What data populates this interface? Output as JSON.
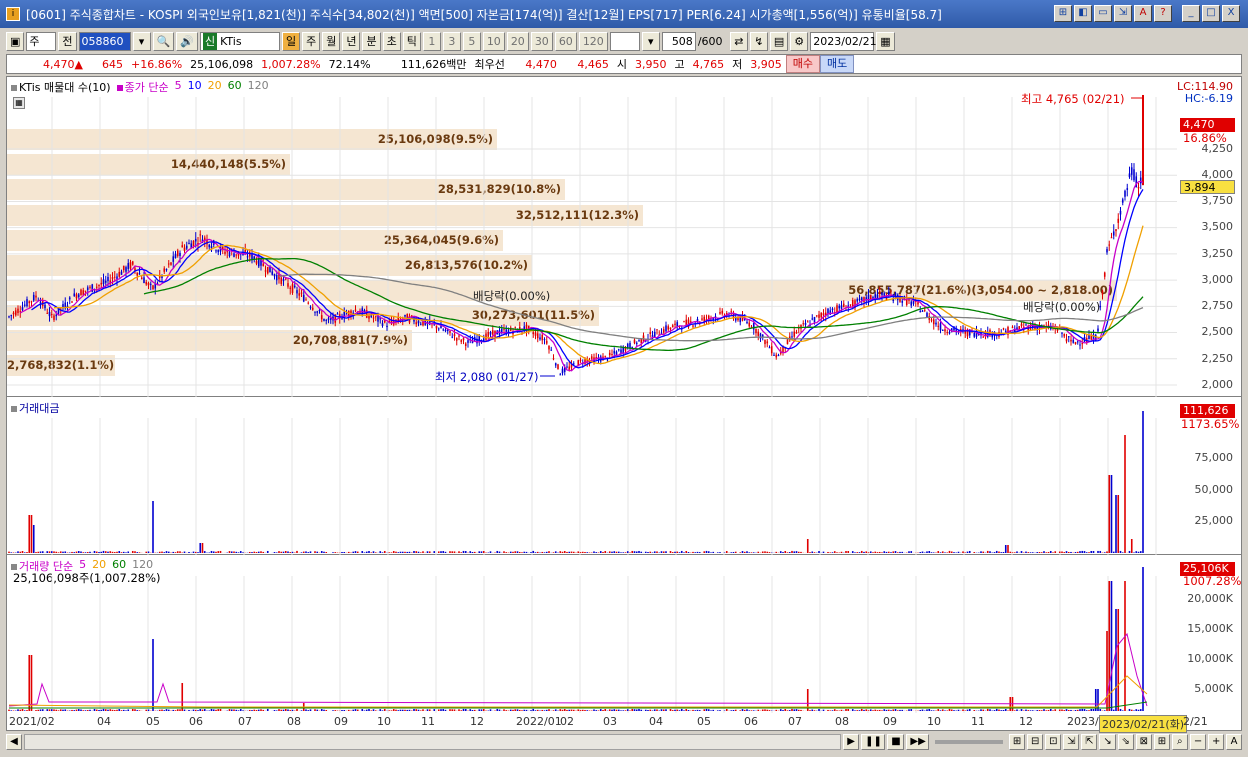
{
  "window": {
    "title": "[0601] 주식종합차트 - KOSPI 외국인보유[1,821(천)] 주식수[34,802(천)] 액면[500] 자본금[174(억)] 결산[12월] EPS[717] PER[6.24] 시가총액[1,556(억)] 유통비율[58.7]",
    "icon": "i",
    "btns": [
      "⊞",
      "◧",
      "▭",
      "⇲",
      "A",
      "?"
    ],
    "ctrl": [
      "_",
      "□",
      "X"
    ]
  },
  "toolbar": {
    "type": "주",
    "mode": "전",
    "code": "058860",
    "name": "KTis",
    "name_badge": "신",
    "periods": [
      "일",
      "주",
      "월",
      "년",
      "분",
      "초",
      "틱"
    ],
    "nums": [
      "1",
      "3",
      "5",
      "10",
      "20",
      "30",
      "60",
      "120"
    ],
    "count": "508",
    "count_max": "/600",
    "date": "2023/02/21"
  },
  "quote": {
    "price": "4,470▲",
    "change": "645",
    "rate": "+16.86%",
    "volume": "25,106,098",
    "vol_rate": "1,007.28%",
    "turnover": "72.14%",
    "amount": "111,626백만",
    "pref_label": "최우선",
    "ask": "4,470",
    "bid": "4,465",
    "open_label": "시",
    "open": "3,950",
    "high_label": "고",
    "high": "4,765",
    "low_label": "저",
    "low": "3,905",
    "buy_label": "매수",
    "sell_label": "매도"
  },
  "price_pane": {
    "legend_title": "KTis 매물대 수(10)",
    "ma_label": "종가 단순",
    "ma_periods": [
      "5",
      "10",
      "20",
      "60",
      "120"
    ],
    "lc": "LC:114.90",
    "hc": "HC:-6.19",
    "yaxis": [
      "4,250",
      "4,000",
      "3,750",
      "3,500",
      "3,250",
      "3,000",
      "2,750",
      "2,500",
      "2,250",
      "2,000"
    ],
    "tag_price": "4,470",
    "tag_rate": "16.86%",
    "tag_ma": "3,894",
    "high_note": "최고 4,765 (02/21)",
    "low_note": "최저 2,080 (01/27)",
    "div1": "배당락(0.00%)",
    "div2": "배당락(0.00%)",
    "profile": [
      "25,106,098(9.5%)",
      "14,440,148(5.5%)",
      "28,531,829(10.8%)",
      "32,512,111(12.3%)",
      "25,364,045(9.6%)",
      "26,813,576(10.2%)",
      "56,855,787(21.6%)(3,054.00 ~ 2,818.00)",
      "30,273,601(11.5%)",
      "20,708,881(7.9%)",
      "2,768,832(1.1%)"
    ]
  },
  "amount_pane": {
    "legend": "거래대금",
    "yaxis": [
      "75,000",
      "50,000",
      "25,000"
    ],
    "tag": "111,626",
    "tag_rate": "1173.65%"
  },
  "volume_pane": {
    "legend": "거래량 단순",
    "ma_periods": [
      "5",
      "20",
      "60",
      "120"
    ],
    "sub": "25,106,098주(1,007.28%)",
    "yaxis": [
      "20,000K",
      "15,000K",
      "10,000K",
      "5,000K"
    ],
    "tag": "25,106K",
    "tag_rate": "1007.28%"
  },
  "xaxis": [
    "2021/02",
    "04",
    "05",
    "06",
    "07",
    "08",
    "09",
    "10",
    "11",
    "12",
    "2022/01",
    "02",
    "03",
    "04",
    "05",
    "06",
    "07",
    "08",
    "09",
    "10",
    "11",
    "12",
    "2023/",
    "2023/02/21(화)",
    "2/21"
  ],
  "colors": {
    "up": "#e00000",
    "down": "#0000d0",
    "ma5": "#c800c8",
    "ma10": "#0000ff",
    "ma20": "#f0a000",
    "ma60": "#008000",
    "ma120": "#808080"
  },
  "chart_data": {
    "type": "candlestick",
    "title": "KTis 주식종합차트",
    "y_range": [
      2000,
      4765
    ],
    "high": {
      "value": 4765,
      "date": "02/21"
    },
    "low": {
      "value": 2080,
      "date": "01/27"
    },
    "last": 4470,
    "volume_profile": [
      {
        "label": "25,106,098(9.5%)"
      },
      {
        "label": "14,440,148(5.5%)"
      },
      {
        "label": "28,531,829(10.8%)"
      },
      {
        "label": "32,512,111(12.3%)"
      },
      {
        "label": "25,364,045(9.6%)"
      },
      {
        "label": "26,813,576(10.2%)"
      },
      {
        "label": "56,855,787(21.6%)"
      },
      {
        "label": "30,273,601(11.5%)"
      },
      {
        "label": "20,708,881(7.9%)"
      },
      {
        "label": "2,768,832(1.1%)"
      }
    ]
  }
}
